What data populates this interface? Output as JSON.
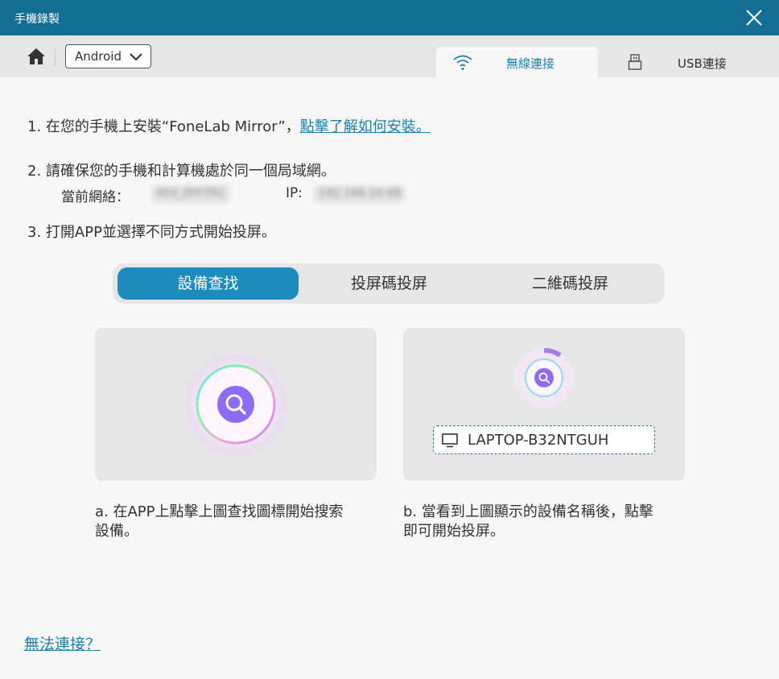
{
  "window": {
    "title": "手機錄製"
  },
  "toolbar": {
    "os_selected": "Android"
  },
  "tabs": {
    "wifi": "無線連接",
    "usb": "USB連接"
  },
  "steps": {
    "s1_prefix": "1. 在您的手機上安裝“FoneLab Mirror”，",
    "s1_link": "點擊了解如何安裝。",
    "s2": "2. 請確保您的手機和計算機處於同一個局域網。",
    "network_label": "當前網絡：",
    "network_value": "403_DIY-TEC",
    "ip_label": "IP:",
    "ip_value": "192.168.10.68",
    "s3": "3. 打開APP並選擇不同方式開始投屏。"
  },
  "modes": [
    "設備查找",
    "投屏碼投屏",
    "二維碼投屏"
  ],
  "active_mode": "設備查找",
  "device": {
    "name": "LAPTOP-B32NTGUH"
  },
  "captions": {
    "a_line1": "a. 在APP上點擊上圖查找圖標開始搜索",
    "a_line2": "設備。",
    "b_line1": "b. 當看到上圖顯示的設備名稱後，點擊",
    "b_line2": "即可開始投屏。"
  },
  "help": {
    "link": "無法連接？"
  },
  "colors": {
    "titlebar": "#146d93",
    "accent": "#1c8bbd",
    "link": "#1f7fa8",
    "search_icon": "#8e6bf5"
  }
}
